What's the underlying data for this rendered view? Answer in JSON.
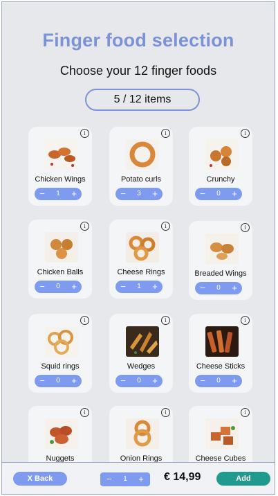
{
  "header": {
    "title": "Finger food selection",
    "subtitle": "Choose your 12 finger foods",
    "counter": "5 / 12 items"
  },
  "items": [
    {
      "name": "Chicken Wings",
      "qty": "1",
      "image": "chicken-wings"
    },
    {
      "name": "Potato curls",
      "qty": "3",
      "image": "potato-curls"
    },
    {
      "name": "Crunchy",
      "qty": "0",
      "image": "crunchy"
    },
    {
      "name": "Chicken Balls",
      "qty": "0",
      "image": "chicken-balls"
    },
    {
      "name": "Cheese Rings",
      "qty": "1",
      "image": "cheese-rings"
    },
    {
      "name": "Breaded Wings",
      "qty": "0",
      "image": "breaded-wings"
    },
    {
      "name": "Squid rings",
      "qty": "0",
      "image": "squid-rings"
    },
    {
      "name": "Wedges",
      "qty": "0",
      "image": "wedges"
    },
    {
      "name": "Cheese Sticks",
      "qty": "0",
      "image": "cheese-sticks"
    },
    {
      "name": "Nuggets",
      "qty": "",
      "image": "nuggets"
    },
    {
      "name": "Onion Rings",
      "qty": "",
      "image": "onion-rings"
    },
    {
      "name": "Cheese Cubes",
      "qty": "",
      "image": "cheese-cubes"
    }
  ],
  "controls": {
    "minus": "−",
    "plus": "+",
    "info": "i"
  },
  "bottom_bar": {
    "back_label": "X Back",
    "qty": "1",
    "price": "€ 14,99",
    "add_label": "Add"
  },
  "colors": {
    "accent": "#7b93d6",
    "stepper": "#7f9bf0",
    "add": "#1f9a8c",
    "background": "#e6e8ec"
  }
}
